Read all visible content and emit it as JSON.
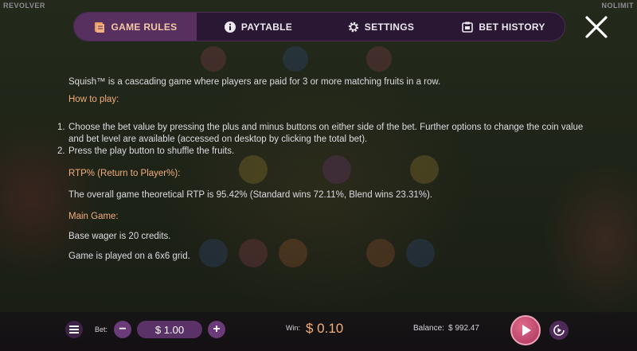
{
  "brand": {
    "left": "REVOLVER",
    "right": "NOLIMIT"
  },
  "tabs": [
    {
      "label": "GAME RULES",
      "icon": "book-icon",
      "active": true
    },
    {
      "label": "PAYTABLE",
      "icon": "info-icon",
      "active": false
    },
    {
      "label": "SETTINGS",
      "icon": "gear-icon",
      "active": false
    },
    {
      "label": "BET HISTORY",
      "icon": "history-icon",
      "active": false
    }
  ],
  "close_icon": "close-icon",
  "rules": {
    "intro": "Squish™ is a cascading game where players are paid for 3 or more matching fruits in a row.",
    "how_to_play_heading": "How to play:",
    "steps": [
      {
        "num": "1.",
        "text": "Choose the bet value by pressing the plus and minus buttons on either side of the bet. Further options to change the coin value and bet level are available (accessed on desktop by clicking the total bet)."
      },
      {
        "num": "2.",
        "text": "Press the play button to shuffle the fruits."
      }
    ],
    "rtp_heading": "RTP% (Return to Player%):",
    "rtp_text": "The overall game theoretical RTP is 95.42% (Standard wins 72.11%, Blend wins 23.31%).",
    "main_game_heading": "Main Game:",
    "main_lines": [
      "Base wager is 20 credits.",
      "Game is played on a 6x6 grid."
    ]
  },
  "bottom": {
    "menu_icon": "hamburger-icon",
    "bet_label": "Bet:",
    "minus": "−",
    "bet_value": "$ 1.00",
    "plus": "+",
    "win_label": "Win:",
    "win_value": "$ 0.10",
    "balance_label": "Balance:",
    "balance_value": "$ 992.47",
    "play_icon": "play-icon",
    "autoplay_icon": "autoplay-icon"
  },
  "colors": {
    "accent": "#f2ae7c",
    "tab_bar": "#2a1733",
    "active_tab": "#57305f",
    "play": "#c24a70"
  }
}
